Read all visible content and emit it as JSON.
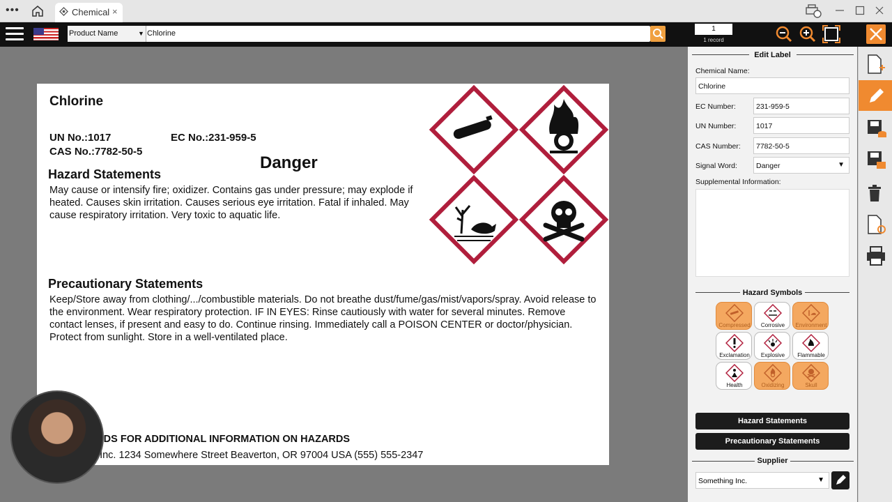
{
  "window": {
    "tab_title": "Chemical",
    "menu_dots": "•••",
    "tab_close": "×"
  },
  "toolbar": {
    "search_field": "Product Name",
    "search_value": "Chlorine",
    "record_number": "1",
    "record_count_label": "1 record"
  },
  "label": {
    "chemical_name": "Chlorine",
    "un_no": "UN No.:1017",
    "ec_no": "EC No.:231-959-5",
    "cas_no": "CAS No.:7782-50-5",
    "signal_word": "Danger",
    "hazard_heading": "Hazard Statements",
    "hazard_text": "May cause or intensify fire; oxidizer. Contains gas under pressure; may explode if heated. Causes skin irritation. Causes serious eye irritation. Fatal if inhaled. May cause respiratory irritation. Very toxic to aquatic life.",
    "precaution_heading": "Precautionary Statements",
    "precaution_text": "Keep/Store away from clothing/.../combustible materials. Do not breathe dust/fume/gas/mist/vapors/spray. Avoid release to the environment. Wear respiratory protection. IF IN EYES: Rinse cautiously with water for several minutes. Remove contact lenses, if present and easy to do. Continue rinsing. Immediately call a POISON CENTER or doctor/physician. Protect from sunlight. Store in a well-ventilated place.",
    "sds_line": "SDS FOR ADDITIONAL INFORMATION ON HAZARDS",
    "supplier_line": "g Inc. 1234 Somewhere Street  Beaverton, OR 97004 USA (555) 555-2347",
    "pictograms": [
      "compressed-gas",
      "oxidizing",
      "environment",
      "skull"
    ],
    "pictogram_border_color": "#b01e3c"
  },
  "panel": {
    "edit_label_title": "Edit Label",
    "chemical_name_label": "Chemical Name:",
    "chemical_name_value": "Chlorine",
    "ec_label": "EC Number:",
    "ec_value": "231-959-5",
    "un_label": "UN Number:",
    "un_value": "1017",
    "cas_label": "CAS Number:",
    "cas_value": "7782-50-5",
    "signal_label": "Signal Word:",
    "signal_value": "Danger",
    "supplemental_label": "Supplemental Information:",
    "hazard_symbols_title": "Hazard Symbols",
    "symbols": [
      {
        "label": "Compressed",
        "selected": true
      },
      {
        "label": "Corrosive",
        "selected": false
      },
      {
        "label": "Environment",
        "selected": true
      },
      {
        "label": "Exclamation",
        "selected": false
      },
      {
        "label": "Explosive",
        "selected": false
      },
      {
        "label": "Flammable",
        "selected": false
      },
      {
        "label": "Health",
        "selected": false
      },
      {
        "label": "Oxidizing",
        "selected": true
      },
      {
        "label": "Skull",
        "selected": true
      }
    ],
    "hazard_statements_btn": "Hazard Statements",
    "precautionary_statements_btn": "Precautionary Statements",
    "supplier_title": "Supplier",
    "supplier_value": "Something Inc."
  },
  "colors": {
    "accent": "#f08a30",
    "selected_symbol": "#f4a860"
  }
}
